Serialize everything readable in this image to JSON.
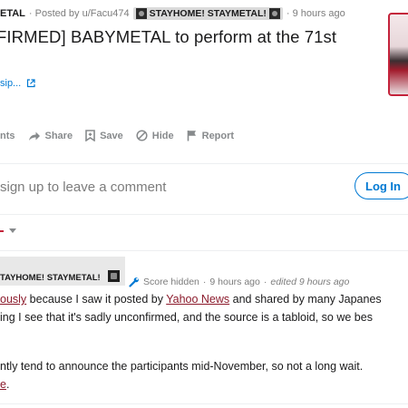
{
  "post": {
    "subreddit_fragment": "ETAL",
    "posted_by": "· Posted by u/Facu474",
    "flair": "STAYHOME! STAYMETAL!",
    "time": "· 9 hours ago",
    "title": "FIRMED] BABYMETAL to perform at the 71st",
    "link_text": "sip..."
  },
  "actions": {
    "comments": "nts",
    "share": "Share",
    "save": "Save",
    "hide": "Hide",
    "report": "Report"
  },
  "signup": {
    "text": "sign up to leave a comment",
    "login": "Log In"
  },
  "comment": {
    "flair": "TAYHOME! STAYMETAL!",
    "score": "Score hidden",
    "dot1": "·",
    "time": "9 hours ago",
    "dot2": "·",
    "edited": "edited 9 hours ago",
    "line1_a": "ously",
    "line1_b": " because I saw it posted by ",
    "line1_link": "Yahoo News",
    "line1_c": " and shared by many Japanes",
    "line2": "ing I see that it's sadly unconfirmed, and the source is a tabloid, so we bes",
    "line3": "ntly tend to announce the participants mid-November, so not a long wait.",
    "line4_link": "e",
    "line4_end": "."
  },
  "colors": {
    "accent_blue": "#0079d3",
    "link_red": "#8b1a2b",
    "muted": "#878a8c"
  }
}
